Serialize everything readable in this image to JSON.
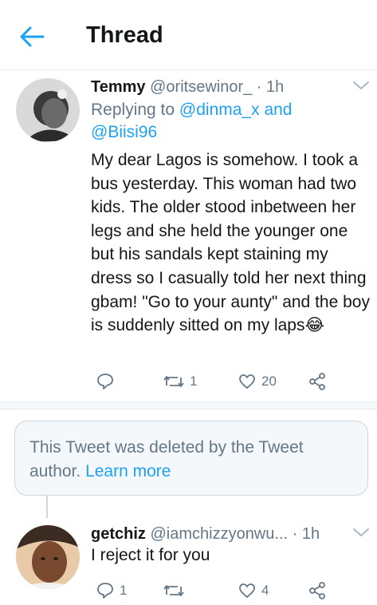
{
  "header": {
    "title": "Thread"
  },
  "tweet1": {
    "name": "Temmy",
    "handle": "@oritsewinor_",
    "time": "1h",
    "replying_prefix": "Replying to",
    "replying_to_1": "@dinma_x",
    "replying_and": "and",
    "replying_to_2": "@Biisi96",
    "text": "My dear Lagos is somehow. I took a bus yesterday. This woman had two kids. The older stood inbetween her legs and she held the younger one but his sandals kept staining my dress so I casually told her next thing gbam! \"Go to your aunty\" and the boy is suddenly sitted on my laps😂",
    "retweets": "1",
    "likes": "20"
  },
  "deleted": {
    "text": "This Tweet was deleted by the Tweet author.",
    "learn_more": "Learn more"
  },
  "tweet2": {
    "name": "getchiz",
    "handle": "@iamchizzyonwu...",
    "time": "1h",
    "text": "I reject it for you",
    "replies": "1",
    "likes": "4"
  },
  "colors": {
    "accent": "#1da1f2",
    "muted": "#657786",
    "text": "#14171a"
  }
}
